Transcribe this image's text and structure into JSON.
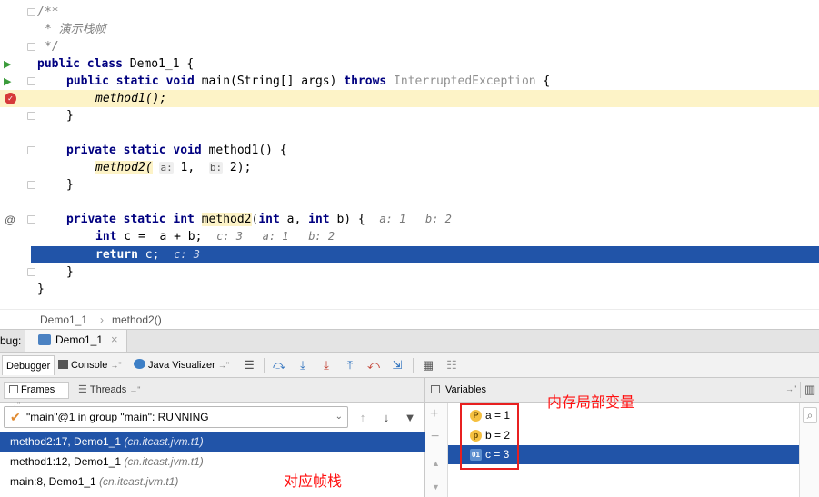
{
  "editor": {
    "lines": {
      "l1": "/**",
      "l2": "* 演示栈帧",
      "l3": "*/",
      "l4_kw": "public class",
      "l4_rest": " Demo1_1 {",
      "l5_kw1": "public static void",
      "l5_mid": " main(String[] args) ",
      "l5_kw2": "throws",
      "l5_exc": " InterruptedException",
      "l5_end": " {",
      "l6": "method1();",
      "l7": "}",
      "l9_kw": "private static void",
      "l9_rest": " method1() {",
      "l10_call": "method2(",
      "l10_hint_a": "a:",
      "l10_val_a": " 1,  ",
      "l10_hint_b": "b:",
      "l10_val_b": " 2);",
      "l11": "}",
      "l13_kw": "private static int",
      "l13_name": "method2",
      "l13_p1": "int",
      "l13_a": " a, ",
      "l13_p2": "int",
      "l13_b": " b) {",
      "l13_inline": "a: 1   b: 2",
      "l14_kw": "int",
      "l14_rest": " c =  a + b;",
      "l14_inline": "c: 3   a: 1   b: 2",
      "l15_kw": "return",
      "l15_rest": " c;",
      "l15_inline": "c: 3",
      "l16": "}",
      "l17": "}"
    }
  },
  "breadcrumb": {
    "item1": "Demo1_1",
    "sep": "›",
    "item2": "method2()"
  },
  "debug_bar": {
    "label": "bug:",
    "tab": "Demo1_1",
    "close": "×"
  },
  "debug_tabs": {
    "debugger": "Debugger",
    "console": "Console",
    "console_pin": "→\"",
    "visualizer": "Java Visualizer",
    "visualizer_pin": "→\""
  },
  "frames_panel": {
    "frames_tab": "Frames",
    "frames_pin": "→\"",
    "threads_tab": "Threads",
    "threads_pin": "→\"",
    "thread_selector": "\"main\"@1 in group \"main\": RUNNING",
    "rows": [
      {
        "method": "method2:17, Demo1_1",
        "package": "(cn.itcast.jvm.t1)"
      },
      {
        "method": "method1:12, Demo1_1",
        "package": "(cn.itcast.jvm.t1)"
      },
      {
        "method": "main:8, Demo1_1",
        "package": "(cn.itcast.jvm.t1)"
      }
    ]
  },
  "variables_panel": {
    "title": "Variables",
    "pin": "→\"",
    "items": [
      {
        "badge": "P",
        "text": "a = 1"
      },
      {
        "badge": "p",
        "text": "b = 2"
      },
      {
        "badge": "01",
        "text": "c = 3"
      }
    ]
  },
  "annotations": {
    "vars_note": "内存局部变量",
    "frames_note": "对应帧栈"
  },
  "colors": {
    "selection": "#2154a8",
    "annotation": "#ff1010",
    "keyword": "#000080"
  }
}
